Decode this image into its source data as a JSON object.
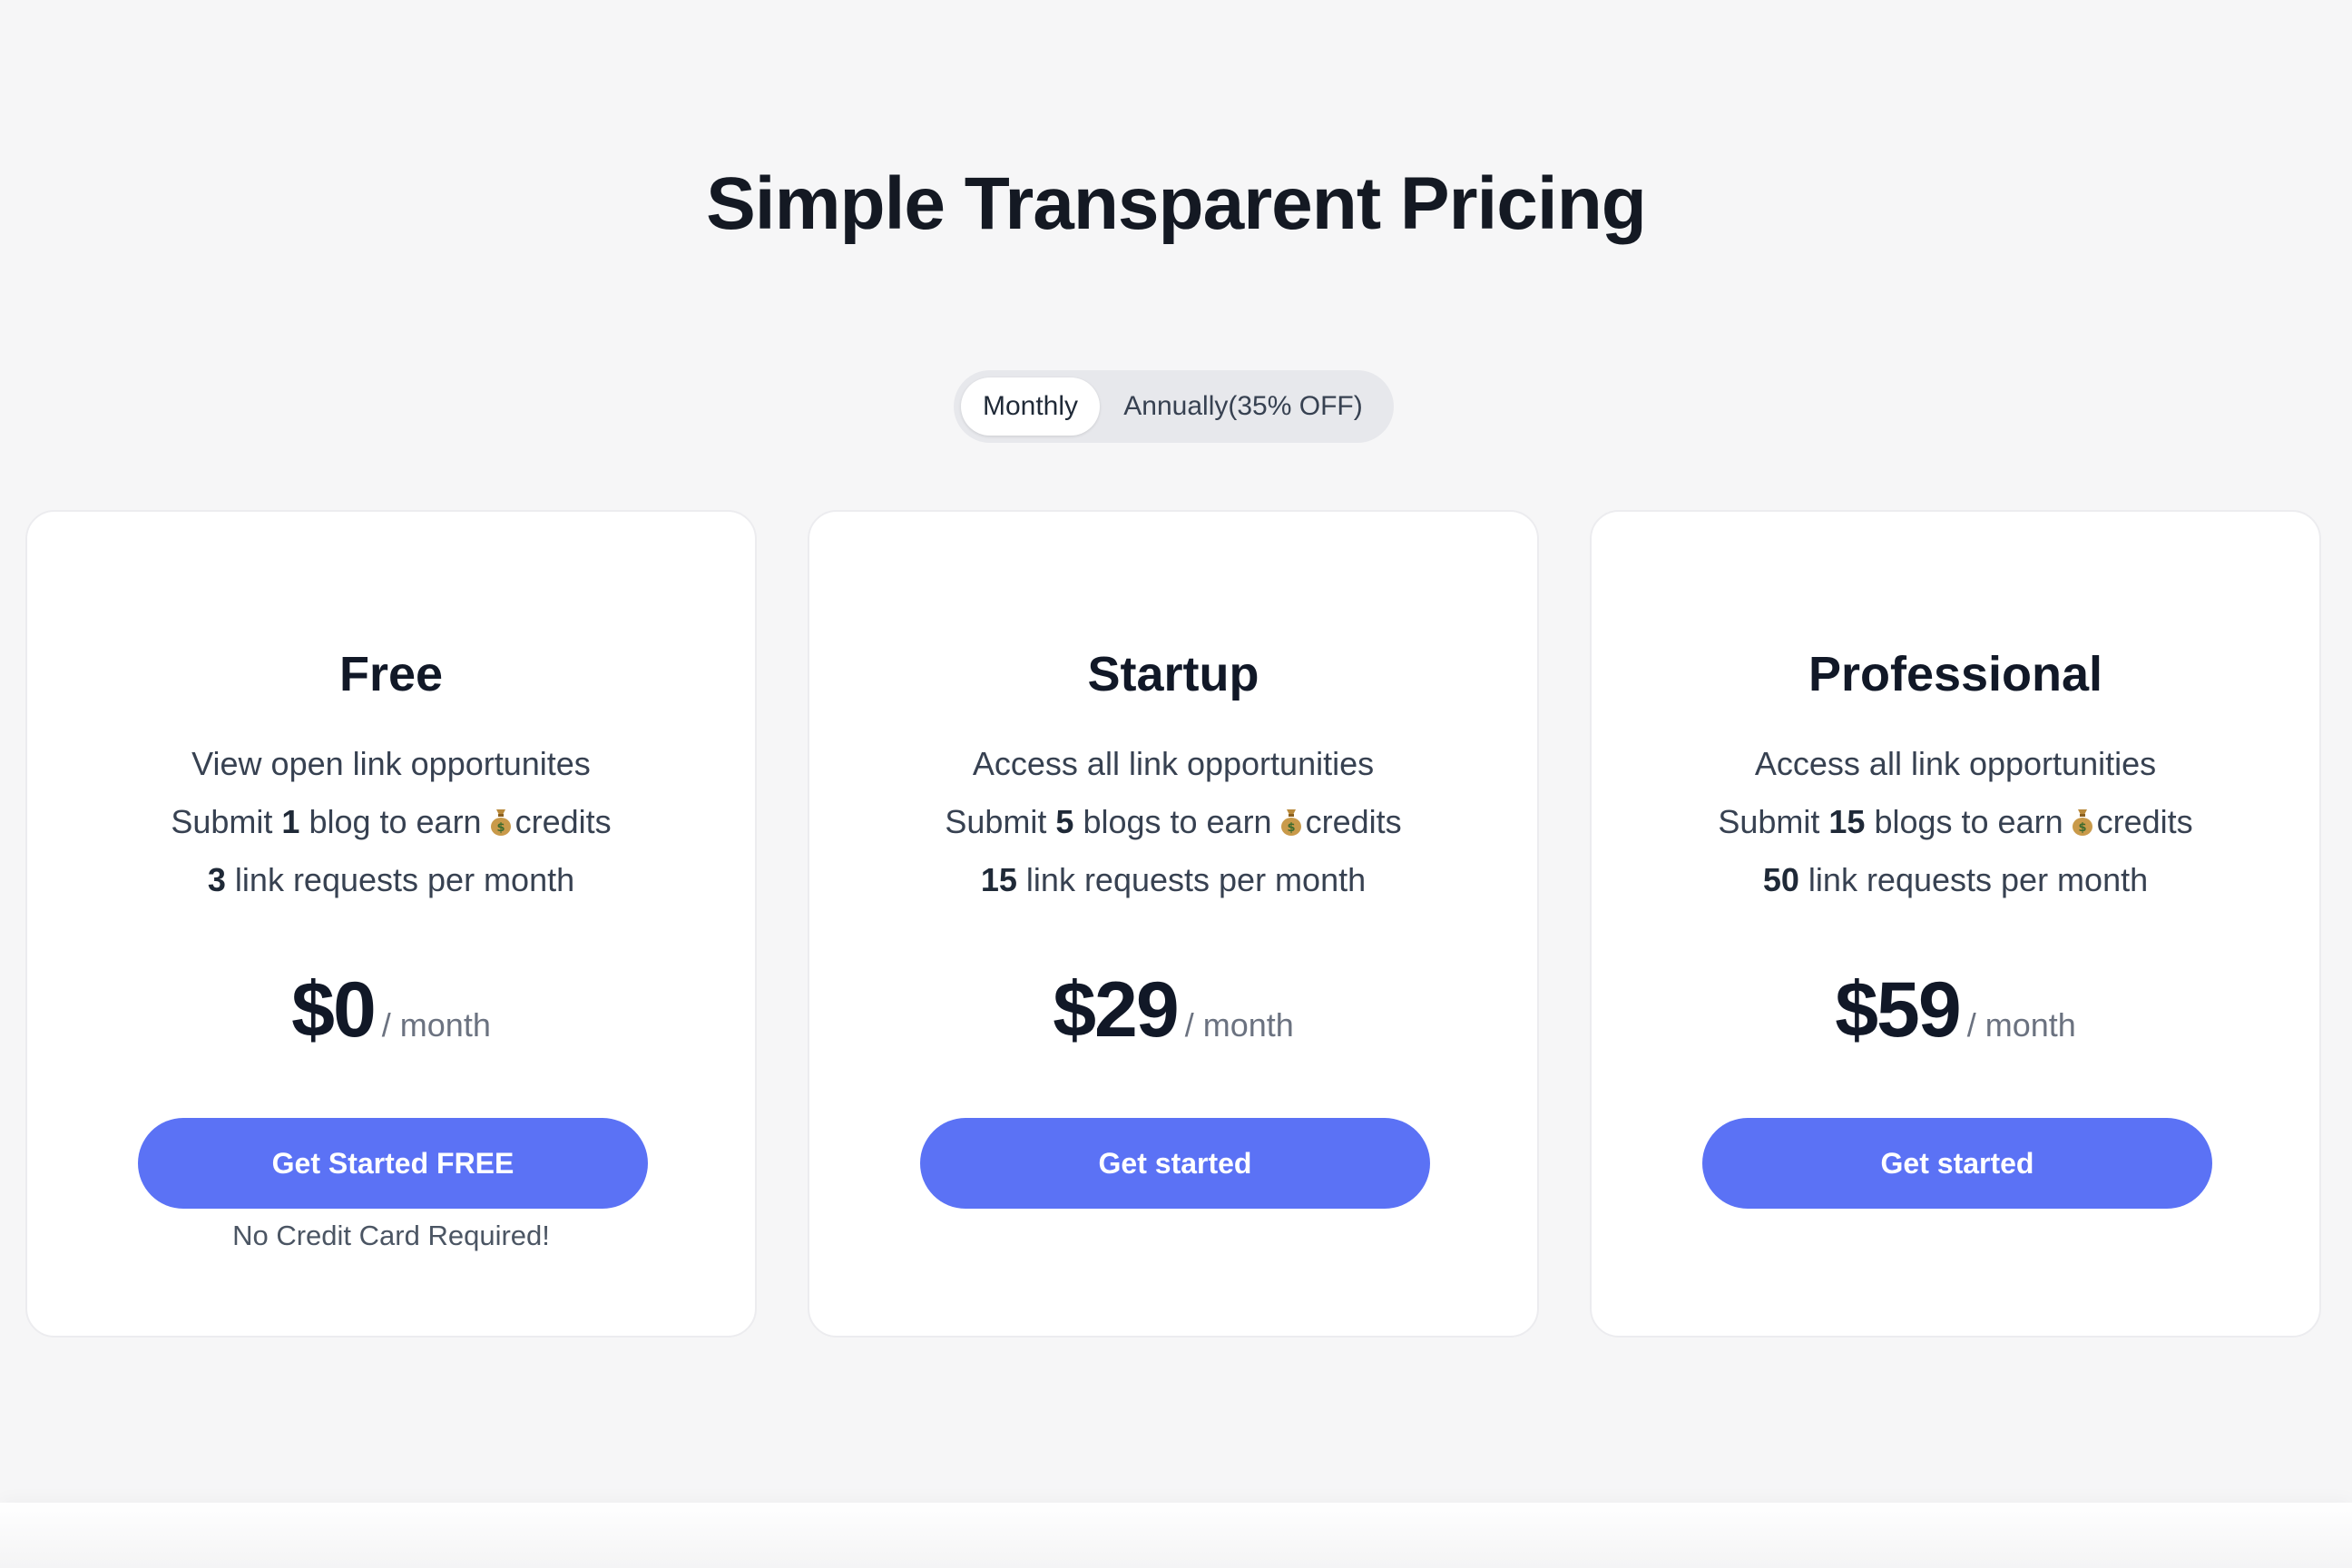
{
  "page": {
    "title": "Simple Transparent Pricing"
  },
  "billing_toggle": {
    "options": [
      "Monthly",
      "Annually(35% OFF)"
    ],
    "selected": "Monthly"
  },
  "plans": [
    {
      "name": "Free",
      "features": [
        {
          "prefix": "",
          "bold": "",
          "suffix": "View open link opportunites",
          "coin": false
        },
        {
          "prefix": "Submit ",
          "bold": "1",
          "suffix": " blog to earn",
          "coin": true,
          "after_coin": "credits"
        },
        {
          "prefix": "",
          "bold": "3",
          "suffix": " link requests per month",
          "coin": false
        }
      ],
      "price": "$0",
      "period": "/ month",
      "cta": "Get Started FREE",
      "note": "No Credit Card Required!"
    },
    {
      "name": "Startup",
      "features": [
        {
          "prefix": "",
          "bold": "",
          "suffix": "Access all link opportunities",
          "coin": false
        },
        {
          "prefix": "Submit ",
          "bold": "5",
          "suffix": " blogs to earn",
          "coin": true,
          "after_coin": "credits"
        },
        {
          "prefix": "",
          "bold": "15",
          "suffix": " link requests per month",
          "coin": false
        }
      ],
      "price": "$29",
      "period": "/ month",
      "cta": "Get started",
      "note": ""
    },
    {
      "name": "Professional",
      "features": [
        {
          "prefix": "",
          "bold": "",
          "suffix": "Access all link opportunities",
          "coin": false
        },
        {
          "prefix": "Submit ",
          "bold": "15",
          "suffix": " blogs to earn",
          "coin": true,
          "after_coin": "credits"
        },
        {
          "prefix": "",
          "bold": "50",
          "suffix": " link requests per month",
          "coin": false
        }
      ],
      "price": "$59",
      "period": "/ month",
      "cta": "Get started",
      "note": ""
    }
  ],
  "icons": {
    "coin": "money-bag-icon"
  },
  "colors": {
    "accent": "#5b72f5",
    "background": "#f6f6f7",
    "card": "#ffffff",
    "heading": "#111827"
  }
}
